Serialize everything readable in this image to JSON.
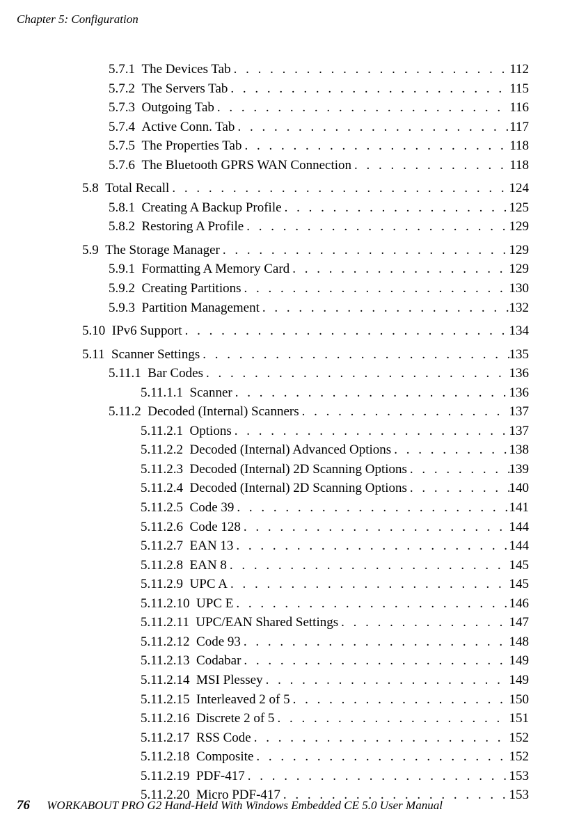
{
  "header": "Chapter 5: Configuration",
  "footer": {
    "page_number": "76",
    "text": "WORKABOUT PRO G2 Hand-Held With Windows Embedded CE 5.0 User Manual"
  },
  "toc": [
    {
      "level": 2,
      "num": "5.7.1",
      "title": "The Devices Tab",
      "page": "112",
      "group_break": false
    },
    {
      "level": 2,
      "num": "5.7.2",
      "title": "The Servers Tab",
      "page": "115",
      "group_break": false
    },
    {
      "level": 2,
      "num": "5.7.3",
      "title": "Outgoing Tab",
      "page": "116",
      "group_break": false
    },
    {
      "level": 2,
      "num": "5.7.4",
      "title": "Active Conn. Tab",
      "page": "117",
      "group_break": false
    },
    {
      "level": 2,
      "num": "5.7.5",
      "title": "The Properties Tab",
      "page": "118",
      "group_break": false
    },
    {
      "level": 2,
      "num": "5.7.6",
      "title": "The Bluetooth GPRS WAN Connection",
      "page": "118",
      "group_break": false
    },
    {
      "level": 1,
      "num": "5.8",
      "title": "Total Recall",
      "page": "124",
      "group_break": true
    },
    {
      "level": 2,
      "num": "5.8.1",
      "title": "Creating A Backup Profile",
      "page": "125",
      "group_break": false
    },
    {
      "level": 2,
      "num": "5.8.2",
      "title": "Restoring A Profile",
      "page": "129",
      "group_break": false
    },
    {
      "level": 1,
      "num": "5.9",
      "title": "The Storage Manager",
      "page": "129",
      "group_break": true
    },
    {
      "level": 2,
      "num": "5.9.1",
      "title": "Formatting A Memory Card",
      "page": "129",
      "group_break": false
    },
    {
      "level": 2,
      "num": "5.9.2",
      "title": "Creating Partitions",
      "page": "130",
      "group_break": false
    },
    {
      "level": 2,
      "num": "5.9.3",
      "title": "Partition Management",
      "page": "132",
      "group_break": false
    },
    {
      "level": 1,
      "num": "5.10",
      "title": "IPv6 Support",
      "page": "134",
      "group_break": true
    },
    {
      "level": 1,
      "num": "5.11",
      "title": "Scanner Settings",
      "page": "135",
      "group_break": true
    },
    {
      "level": 2,
      "num": "5.11.1",
      "title": "Bar Codes",
      "page": "136",
      "group_break": false
    },
    {
      "level": 3,
      "num": "5.11.1.1",
      "title": "Scanner",
      "page": "136",
      "group_break": false
    },
    {
      "level": 2,
      "num": "5.11.2",
      "title": "Decoded (Internal) Scanners",
      "page": "137",
      "group_break": false
    },
    {
      "level": 3,
      "num": "5.11.2.1",
      "title": "Options",
      "page": "137",
      "group_break": false
    },
    {
      "level": 3,
      "num": "5.11.2.2",
      "title": "Decoded (Internal) Advanced Options",
      "page": "138",
      "group_break": false
    },
    {
      "level": 3,
      "num": "5.11.2.3",
      "title": "Decoded (Internal) 2D Scanning Options",
      "page": "139",
      "group_break": false
    },
    {
      "level": 3,
      "num": "5.11.2.4",
      "title": "Decoded (Internal) 2D Scanning Options",
      "page": "140",
      "group_break": false
    },
    {
      "level": 3,
      "num": "5.11.2.5",
      "title": "Code 39",
      "page": "141",
      "group_break": false
    },
    {
      "level": 3,
      "num": "5.11.2.6",
      "title": "Code 128",
      "page": "144",
      "group_break": false
    },
    {
      "level": 3,
      "num": "5.11.2.7",
      "title": "EAN 13",
      "page": "144",
      "group_break": false
    },
    {
      "level": 3,
      "num": "5.11.2.8",
      "title": "EAN 8",
      "page": "145",
      "group_break": false
    },
    {
      "level": 3,
      "num": "5.11.2.9",
      "title": "UPC A",
      "page": "145",
      "group_break": false
    },
    {
      "level": 3,
      "num": "5.11.2.10",
      "title": "UPC E",
      "page": "146",
      "group_break": false
    },
    {
      "level": 3,
      "num": "5.11.2.11",
      "title": "UPC/EAN Shared Settings",
      "page": "147",
      "group_break": false
    },
    {
      "level": 3,
      "num": "5.11.2.12",
      "title": "Code 93",
      "page": "148",
      "group_break": false
    },
    {
      "level": 3,
      "num": "5.11.2.13",
      "title": "Codabar",
      "page": "149",
      "group_break": false
    },
    {
      "level": 3,
      "num": "5.11.2.14",
      "title": "MSI Plessey",
      "page": "149",
      "group_break": false
    },
    {
      "level": 3,
      "num": "5.11.2.15",
      "title": "Interleaved 2 of 5",
      "page": "150",
      "group_break": false
    },
    {
      "level": 3,
      "num": "5.11.2.16",
      "title": "Discrete 2 of 5",
      "page": "151",
      "group_break": false
    },
    {
      "level": 3,
      "num": "5.11.2.17",
      "title": "RSS Code",
      "page": "152",
      "group_break": false
    },
    {
      "level": 3,
      "num": "5.11.2.18",
      "title": "Composite",
      "page": "152",
      "group_break": false
    },
    {
      "level": 3,
      "num": "5.11.2.19",
      "title": "PDF-417",
      "page": "153",
      "group_break": false
    },
    {
      "level": 3,
      "num": "5.11.2.20",
      "title": "Micro PDF-417",
      "page": "153",
      "group_break": false
    }
  ]
}
